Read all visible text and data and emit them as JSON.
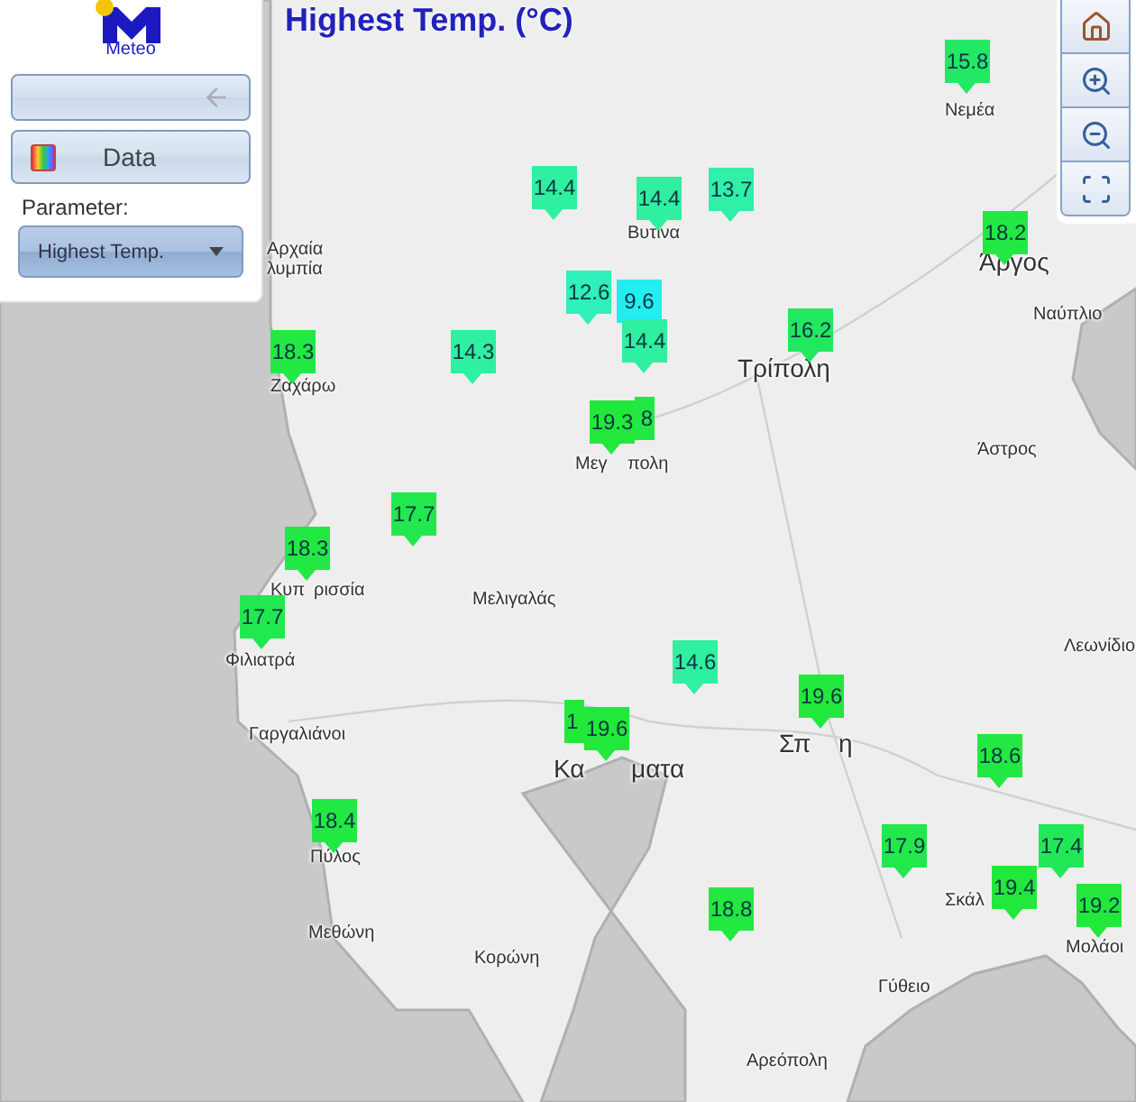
{
  "panel": {
    "logo_text": "Meteo",
    "data_button": "Data",
    "parameter_label": "Parameter:",
    "parameter_select": "Highest Temp."
  },
  "title": "Highest Temp. (°C)",
  "places": [
    {
      "name": "Αρχαία",
      "kind": "small"
    },
    {
      "name": "λυμπία",
      "kind": "small"
    },
    {
      "name": "Νεμέα",
      "kind": "small"
    },
    {
      "name": "Βυτίνα",
      "kind": "small"
    },
    {
      "name": "Άργος",
      "kind": "large"
    },
    {
      "name": "Ναύπλιο",
      "kind": "small"
    },
    {
      "name": "Τρίπολη",
      "kind": "large"
    },
    {
      "name": "Ζαχάρω",
      "kind": "small"
    },
    {
      "name": "Μεγ",
      "kind": "small"
    },
    {
      "name": "πολη",
      "kind": "small"
    },
    {
      "name": "Άστρος",
      "kind": "small"
    },
    {
      "name": "Μελιγαλάς",
      "kind": "small"
    },
    {
      "name": "Κυπ",
      "kind": "small"
    },
    {
      "name": "ρισσία",
      "kind": "small"
    },
    {
      "name": "Φιλιατρά",
      "kind": "small"
    },
    {
      "name": "Λεωνίδιο",
      "kind": "small"
    },
    {
      "name": "Γαργαλιάνοι",
      "kind": "small"
    },
    {
      "name": "Κα",
      "kind": "large"
    },
    {
      "name": "ματα",
      "kind": "large"
    },
    {
      "name": "Σπ",
      "kind": "large"
    },
    {
      "name": "η",
      "kind": "large"
    },
    {
      "name": "Σκάλ",
      "kind": "small"
    },
    {
      "name": "Πύλος",
      "kind": "small"
    },
    {
      "name": "Μεθώνη",
      "kind": "small"
    },
    {
      "name": "Κορώνη",
      "kind": "small"
    },
    {
      "name": "Γύθειο",
      "kind": "small"
    },
    {
      "name": "Μολάοι",
      "kind": "small"
    },
    {
      "name": "Αρεόπολη",
      "kind": "small"
    }
  ],
  "markers": [
    {
      "value": "15.8",
      "color": "#22e866",
      "kind": "front"
    },
    {
      "value": "14.4",
      "color": "#2ef0a0",
      "kind": "front"
    },
    {
      "value": "14.4",
      "color": "#2ef0a0",
      "kind": "front"
    },
    {
      "value": "13.7",
      "color": "#2ef0a8",
      "kind": "front"
    },
    {
      "value": "18.2",
      "color": "#22e844",
      "kind": "front"
    },
    {
      "value": "12.6",
      "color": "#2ef0b8",
      "kind": "front"
    },
    {
      "value": "9.6",
      "color": "#22eef0",
      "kind": "front"
    },
    {
      "value": "14.4",
      "color": "#2ef0a0",
      "kind": "front"
    },
    {
      "value": "16.2",
      "color": "#22e860",
      "kind": "front"
    },
    {
      "value": "18.3",
      "color": "#22e844",
      "kind": "front"
    },
    {
      "value": "14.3",
      "color": "#2ef0a0",
      "kind": "front"
    },
    {
      "value": "8",
      "color": "#22e844",
      "kind": "back-right"
    },
    {
      "value": "19.3",
      "color": "#22e83c",
      "kind": "front"
    },
    {
      "value": "17.7",
      "color": "#22e850",
      "kind": "front"
    },
    {
      "value": "18.3",
      "color": "#22e844",
      "kind": "front"
    },
    {
      "value": "17.7",
      "color": "#22e850",
      "kind": "front"
    },
    {
      "value": "14.6",
      "color": "#2ef0a0",
      "kind": "front"
    },
    {
      "value": "1",
      "color": "#22e83c",
      "kind": "back-left"
    },
    {
      "value": "19.6",
      "color": "#22e83c",
      "kind": "front"
    },
    {
      "value": "19.6",
      "color": "#22e83c",
      "kind": "front"
    },
    {
      "value": "18.6",
      "color": "#22e844",
      "kind": "front"
    },
    {
      "value": "18.4",
      "color": "#22e844",
      "kind": "front"
    },
    {
      "value": "17.9",
      "color": "#22e84c",
      "kind": "front"
    },
    {
      "value": "17.4",
      "color": "#22e858",
      "kind": "front"
    },
    {
      "value": "19.4",
      "color": "#22e83c",
      "kind": "front"
    },
    {
      "value": "18.8",
      "color": "#22e840",
      "kind": "front"
    },
    {
      "value": "19.2",
      "color": "#22e83c",
      "kind": "front"
    }
  ]
}
